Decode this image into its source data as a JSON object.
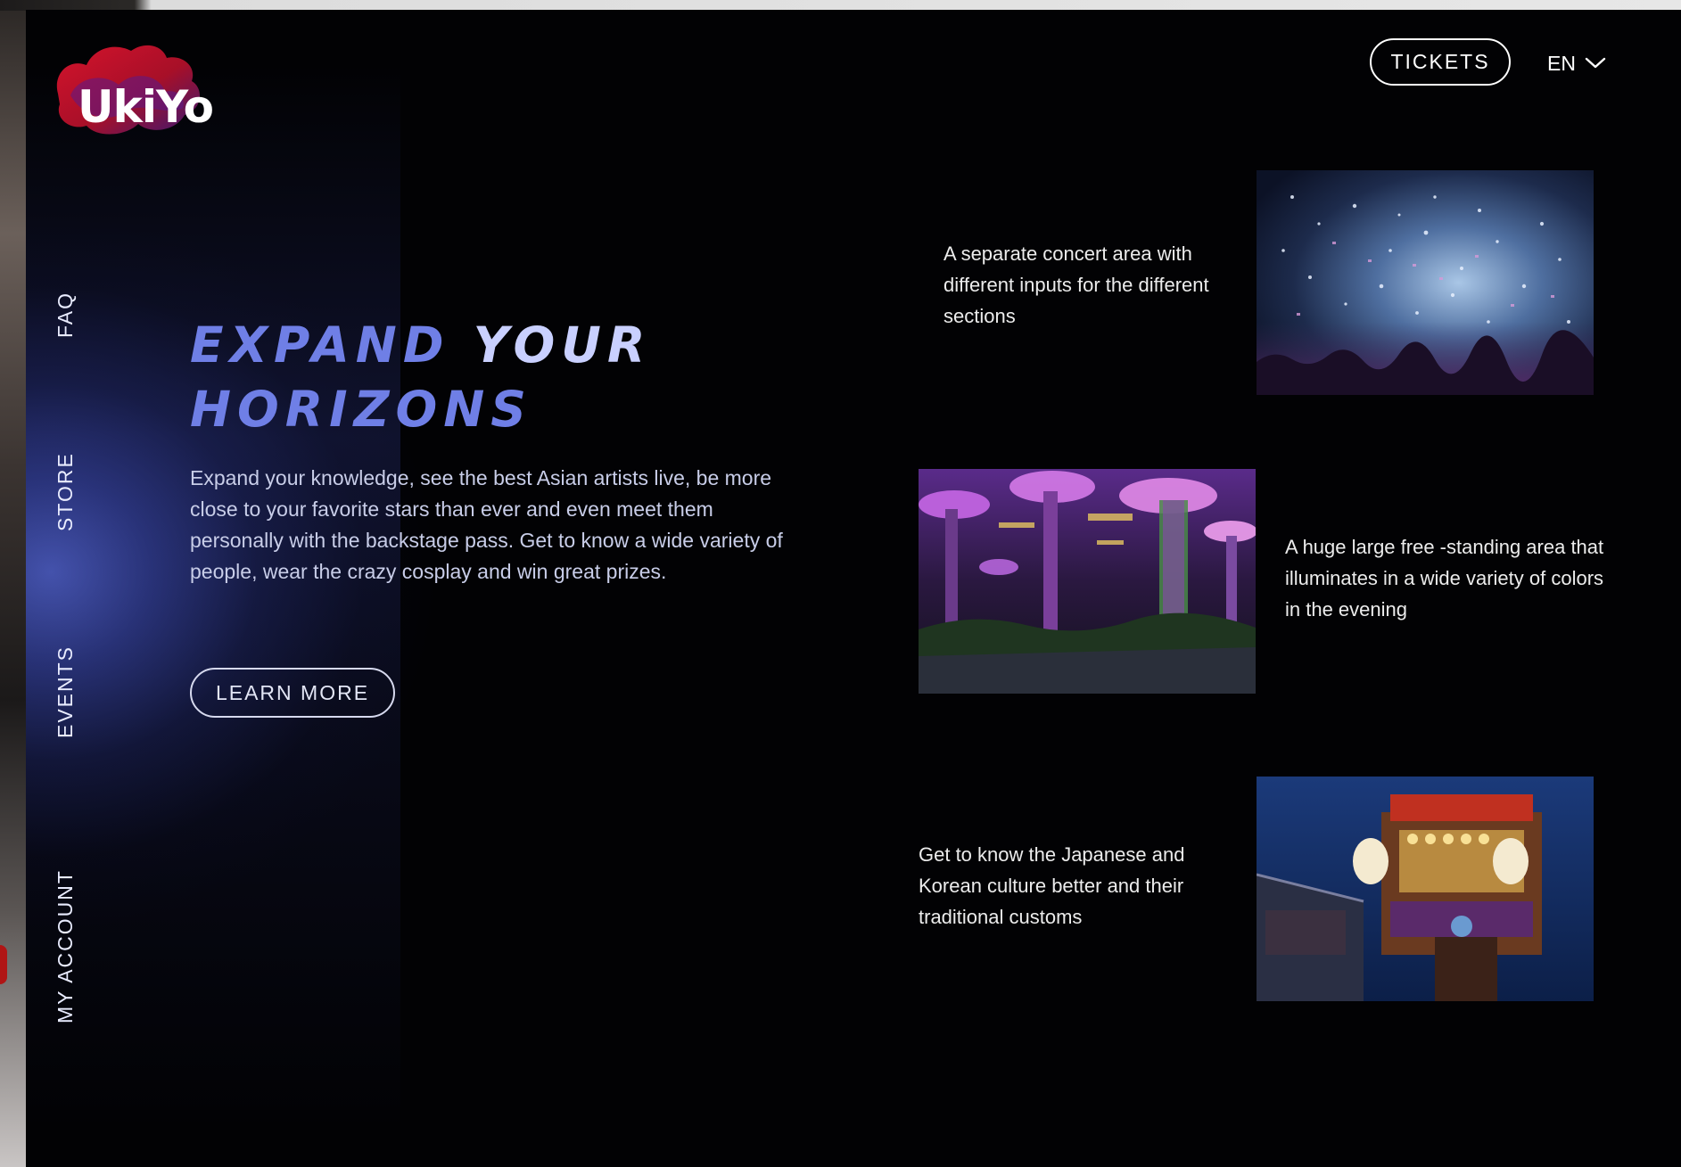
{
  "brand": {
    "logo_text": "UkiYo"
  },
  "header": {
    "tickets_label": "TICKETS",
    "language": "EN"
  },
  "side_nav": {
    "items": [
      {
        "label": "FAQ"
      },
      {
        "label": "STORE"
      },
      {
        "label": "EVENTS"
      },
      {
        "label": "MY ACCOUNT"
      }
    ]
  },
  "hero": {
    "title_part1": "EXPAND",
    "title_part2": "YOUR",
    "title_part3": "HORIZONS",
    "description": "Expand your knowledge, see the best Asian artists live, be more close to your favorite stars than ever and even meet them personally with the backstage pass. Get to know a wide variety of people, wear the crazy cosplay and win great prizes.",
    "learn_more_label": "LEARN MORE"
  },
  "features": [
    {
      "text": "A separate concert area with different inputs for the different sections",
      "image": "concert-confetti-photo"
    },
    {
      "text": "A huge large free -standing area that illuminates in a wide variety of colors in the evening",
      "image": "illuminated-garden-photo"
    },
    {
      "text": "Get to know the Japanese and Korean culture better and their traditional customs",
      "image": "japanese-festival-float-photo"
    }
  ],
  "colors": {
    "background": "#020204",
    "accent_blue": "#6f7fe6",
    "title_light": "#c9d0ff",
    "logo_red": "#c4102a"
  },
  "icons": {
    "language_chevron": "chevron-down-icon"
  }
}
